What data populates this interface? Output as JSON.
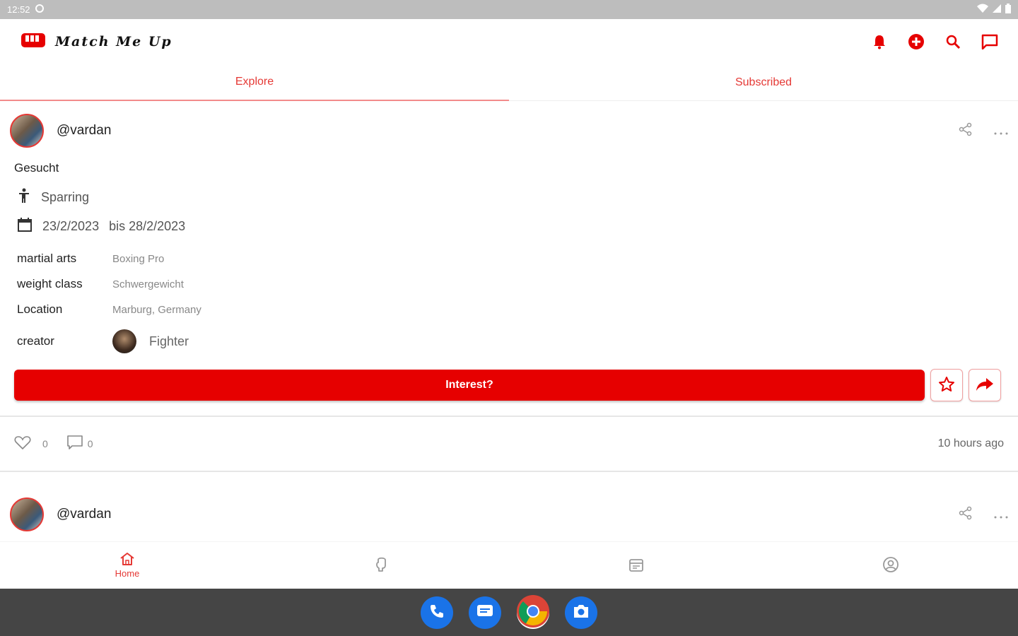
{
  "status_bar": {
    "time": "12:52"
  },
  "app": {
    "logo_text": "Match Me Up",
    "accent_color": "#e60000",
    "actions": [
      "bell-icon",
      "add-circle-icon",
      "search-icon",
      "chat-icon"
    ]
  },
  "tabs": [
    {
      "label": "Explore",
      "active": true
    },
    {
      "label": "Subscribed",
      "active": false
    }
  ],
  "post1": {
    "username": "@vardan",
    "section_label": "Gesucht",
    "type_label": "Sparring",
    "date_from": "23/2/2023",
    "date_to": "bis 28/2/2023",
    "fields": [
      {
        "key": "martial arts",
        "value": "Boxing Pro"
      },
      {
        "key": "weight class",
        "value": "Schwergewicht"
      },
      {
        "key": "Location",
        "value": "Marburg, Germany"
      }
    ],
    "creator_label": "creator",
    "creator_name": "Fighter",
    "interest_label": "Interest?",
    "likes": "0",
    "comments": "0",
    "time_ago": "10 hours ago"
  },
  "post2": {
    "username": "@vardan"
  },
  "bottom_nav": [
    {
      "label": "Home",
      "icon": "home-icon",
      "active": true
    },
    {
      "label": "",
      "icon": "boxing-glove-icon",
      "active": false
    },
    {
      "label": "",
      "icon": "calendar-icon",
      "active": false
    },
    {
      "label": "",
      "icon": "profile-icon",
      "active": false
    }
  ],
  "dock_apps": [
    "phone-icon",
    "messages-icon",
    "chrome-icon",
    "camera-icon"
  ]
}
